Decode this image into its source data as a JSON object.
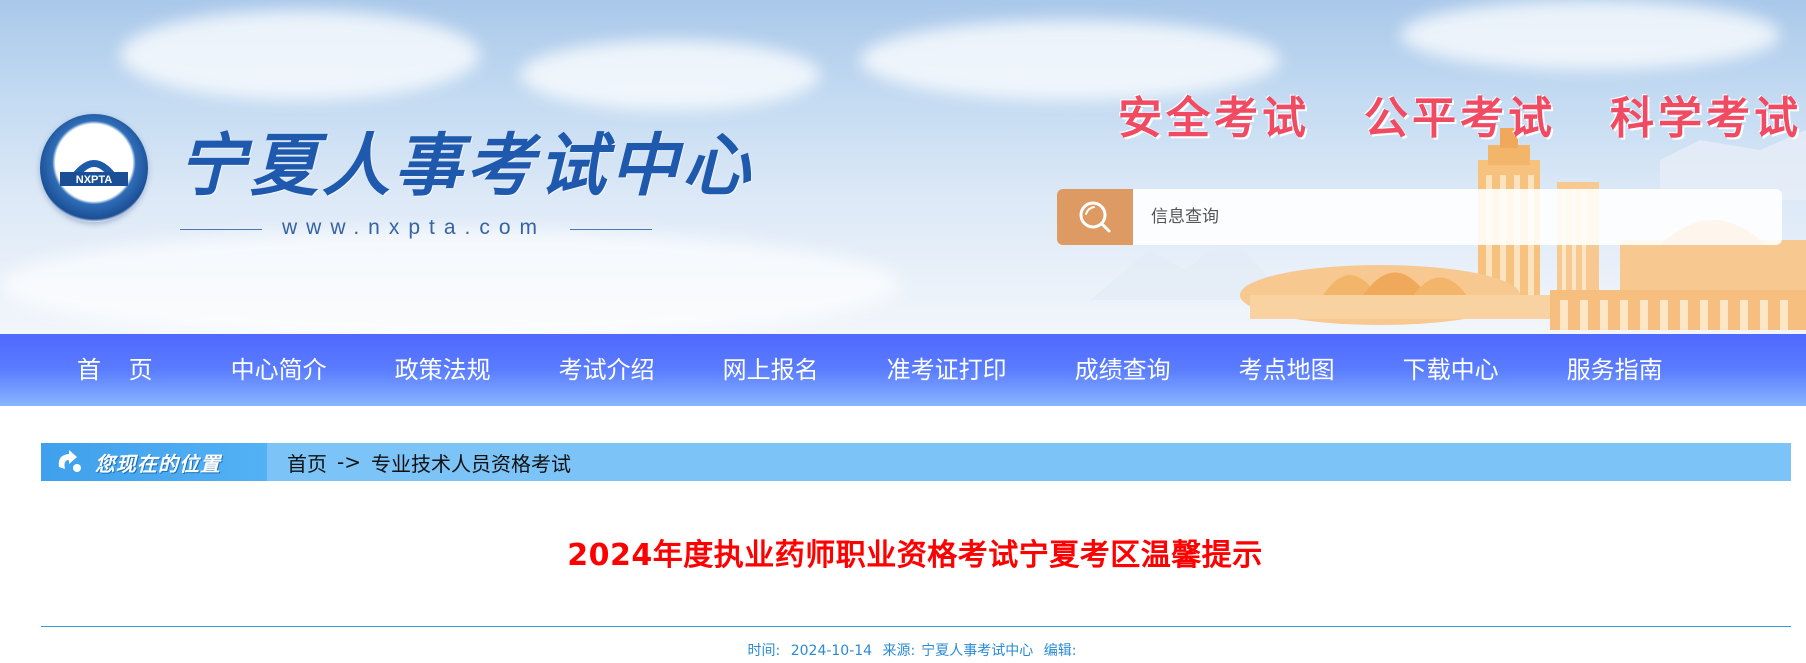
{
  "header": {
    "logo_emblem_text": "NXPTA",
    "site_title": "宁夏人事考试中心",
    "site_url": "www.nxpta.com",
    "slogans": [
      "安全考试",
      "公平考试",
      "科学考试"
    ],
    "search": {
      "placeholder": "信息查询",
      "icon": "search-icon"
    }
  },
  "nav": {
    "items": [
      {
        "label": "首 页"
      },
      {
        "label": "中心简介"
      },
      {
        "label": "政策法规"
      },
      {
        "label": "考试介绍"
      },
      {
        "label": "网上报名"
      },
      {
        "label": "准考证打印"
      },
      {
        "label": "成绩查询"
      },
      {
        "label": "考点地图"
      },
      {
        "label": "下载中心"
      },
      {
        "label": "服务指南"
      }
    ]
  },
  "breadcrumb": {
    "label": "您现在的位置",
    "home": "首页",
    "separator": "->",
    "current": "专业技术人员资格考试"
  },
  "article": {
    "title": "2024年度执业药师职业资格考试宁夏考区温馨提示",
    "time_label": "时间:",
    "time_value": "2024-10-14",
    "source_label": "来源:",
    "source_value": "宁夏人事考试中心",
    "editor_label": "编辑:",
    "editor_value": ""
  },
  "colors": {
    "title_red": "#ff0000",
    "slogan_pink": "#f14a63",
    "nav_blue": "#5a7dff",
    "crumb_blue": "#7cc4f7",
    "search_orange": "#dd9a63"
  }
}
